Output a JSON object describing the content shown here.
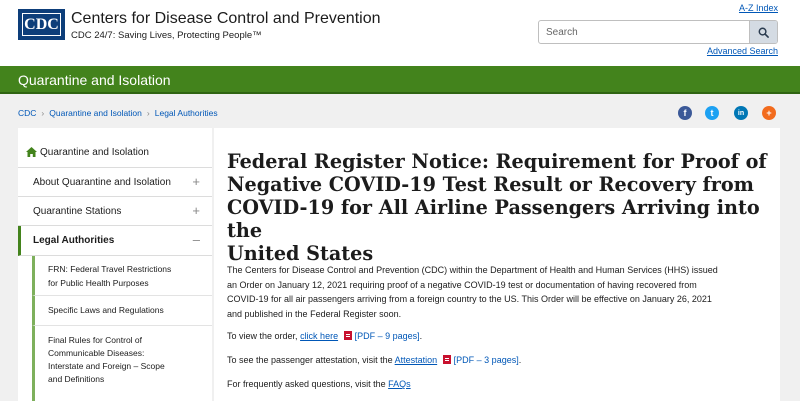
{
  "header": {
    "logo_text": "CDC",
    "org_name": "Centers for Disease Control and Prevention",
    "tagline": "CDC 24/7: Saving Lives, Protecting People™",
    "az_index": "A-Z Index",
    "search_placeholder": "Search",
    "advanced_search": "Advanced Search"
  },
  "section_bar": {
    "title": "Quarantine and Isolation"
  },
  "breadcrumb": [
    "CDC",
    "Quarantine and Isolation",
    "Legal Authorities"
  ],
  "social": [
    {
      "name": "facebook",
      "glyph": "f",
      "color": "#3b5998"
    },
    {
      "name": "twitter",
      "glyph": "t",
      "color": "#1da1f2"
    },
    {
      "name": "linkedin",
      "glyph": "in",
      "color": "#0077b5"
    },
    {
      "name": "syndicate",
      "glyph": "+",
      "color": "#f26b1d"
    }
  ],
  "nav": {
    "home": "Quarantine and Isolation",
    "about": "About Quarantine and Isolation",
    "stations": "Quarantine Stations",
    "legal": "Legal Authorities",
    "sub": {
      "frn_line1": "FRN: Federal Travel Restrictions",
      "frn_line2": "for Public Health Purposes",
      "laws": "Specific Laws and Regulations",
      "rules_line1": "Final Rules for Control of",
      "rules_line2": "Communicable Diseases:",
      "rules_line3": "Interstate and Foreign – Scope",
      "rules_line4": "and Definitions"
    }
  },
  "main": {
    "title_line1": "Federal Register Notice: Requirement for Proof of",
    "title_line2": "Negative COVID-19 Test Result or Recovery from",
    "title_line3": "COVID-19 for All Airline Passengers Arriving into the",
    "title_line4": "United States",
    "para_line1": "The Centers for Disease Control and Prevention (CDC) within the Department of Health and Human Services (HHS) issued",
    "para_line2": "an Order on January 12, 2021 requiring proof of a negative COVID-19 test or documentation of having recovered from",
    "para_line3": "COVID-19 for all air passengers arriving from a foreign country to the US. This Order will be effective on January 26, 2021",
    "para_line4": "and published in the Federal Register soon.",
    "order_prefix": "To view the order,",
    "order_link": "click here",
    "order_pdf": "[PDF – 9 pages]",
    "order_suffix": ".",
    "attest_prefix": "To see the passenger attestation, visit the",
    "attest_link": "Attestation",
    "attest_pdf": "[PDF – 3 pages]",
    "attest_suffix": ".",
    "faq_prefix": "For frequently asked questions, visit the",
    "faq_link": "FAQs"
  }
}
